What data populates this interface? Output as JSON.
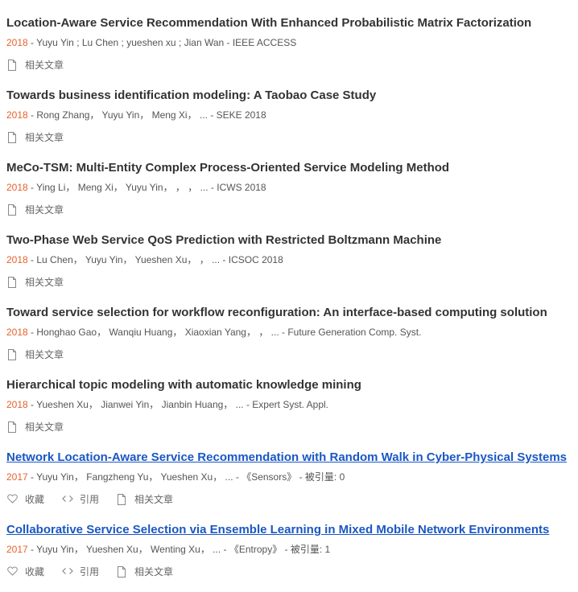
{
  "labels": {
    "related": "相关文章",
    "collect": "收藏",
    "cite": "引用"
  },
  "papers": [
    {
      "title": "Location-Aware Service Recommendation With Enhanced Probabilistic Matrix Factorization",
      "linked": false,
      "year": "2018",
      "meta": " - Yuyu Yin ; Lu Chen ; yueshen xu ; Jian Wan - IEEE ACCESS",
      "full_actions": false
    },
    {
      "title": "Towards business identification modeling: A Taobao Case Study",
      "linked": false,
      "year": "2018",
      "meta": " - Rong Zhang， Yuyu Yin， Meng Xi， ... - SEKE 2018",
      "full_actions": false
    },
    {
      "title": "MeCo-TSM: Multi-Entity Complex Process-Oriented Service Modeling Method",
      "linked": false,
      "year": "2018",
      "meta": " - Ying Li， Meng Xi， Yuyu Yin， ， ， ... - ICWS 2018",
      "full_actions": false
    },
    {
      "title": "Two-Phase Web Service QoS Prediction with Restricted Boltzmann Machine",
      "linked": false,
      "year": "2018",
      "meta": " - Lu Chen， Yuyu Yin， Yueshen Xu， ， ... - ICSOC 2018",
      "full_actions": false
    },
    {
      "title": "Toward service selection for workflow reconfiguration: An interface-based computing solution",
      "linked": false,
      "year": "2018",
      "meta": " - Honghao Gao， Wanqiu Huang， Xiaoxian Yang， ， ... -  Future Generation Comp. Syst.",
      "full_actions": false
    },
    {
      "title": "Hierarchical topic modeling with automatic knowledge mining",
      "linked": false,
      "year": "2018",
      "meta": " - Yueshen Xu， Jianwei Yin， Jianbin Huang， ... - Expert Syst. Appl.",
      "full_actions": false
    },
    {
      "title": "Network Location-Aware Service Recommendation with Random Walk in Cyber-Physical Systems",
      "linked": true,
      "year": "2017",
      "meta": " - Yuyu Yin， Fangzheng Yu， Yueshen Xu， ... - 《Sensors》 - 被引量: 0",
      "full_actions": true
    },
    {
      "title": "Collaborative Service Selection via Ensemble Learning in Mixed Mobile Network Environments",
      "linked": true,
      "year": "2017",
      "meta": " - Yuyu Yin， Yueshen Xu， Wenting Xu， ... - 《Entropy》 - 被引量: 1",
      "full_actions": true
    }
  ],
  "colors": {
    "year": "#e8612c",
    "link": "#1a57c4",
    "title": "#333333",
    "meta": "#555555"
  }
}
